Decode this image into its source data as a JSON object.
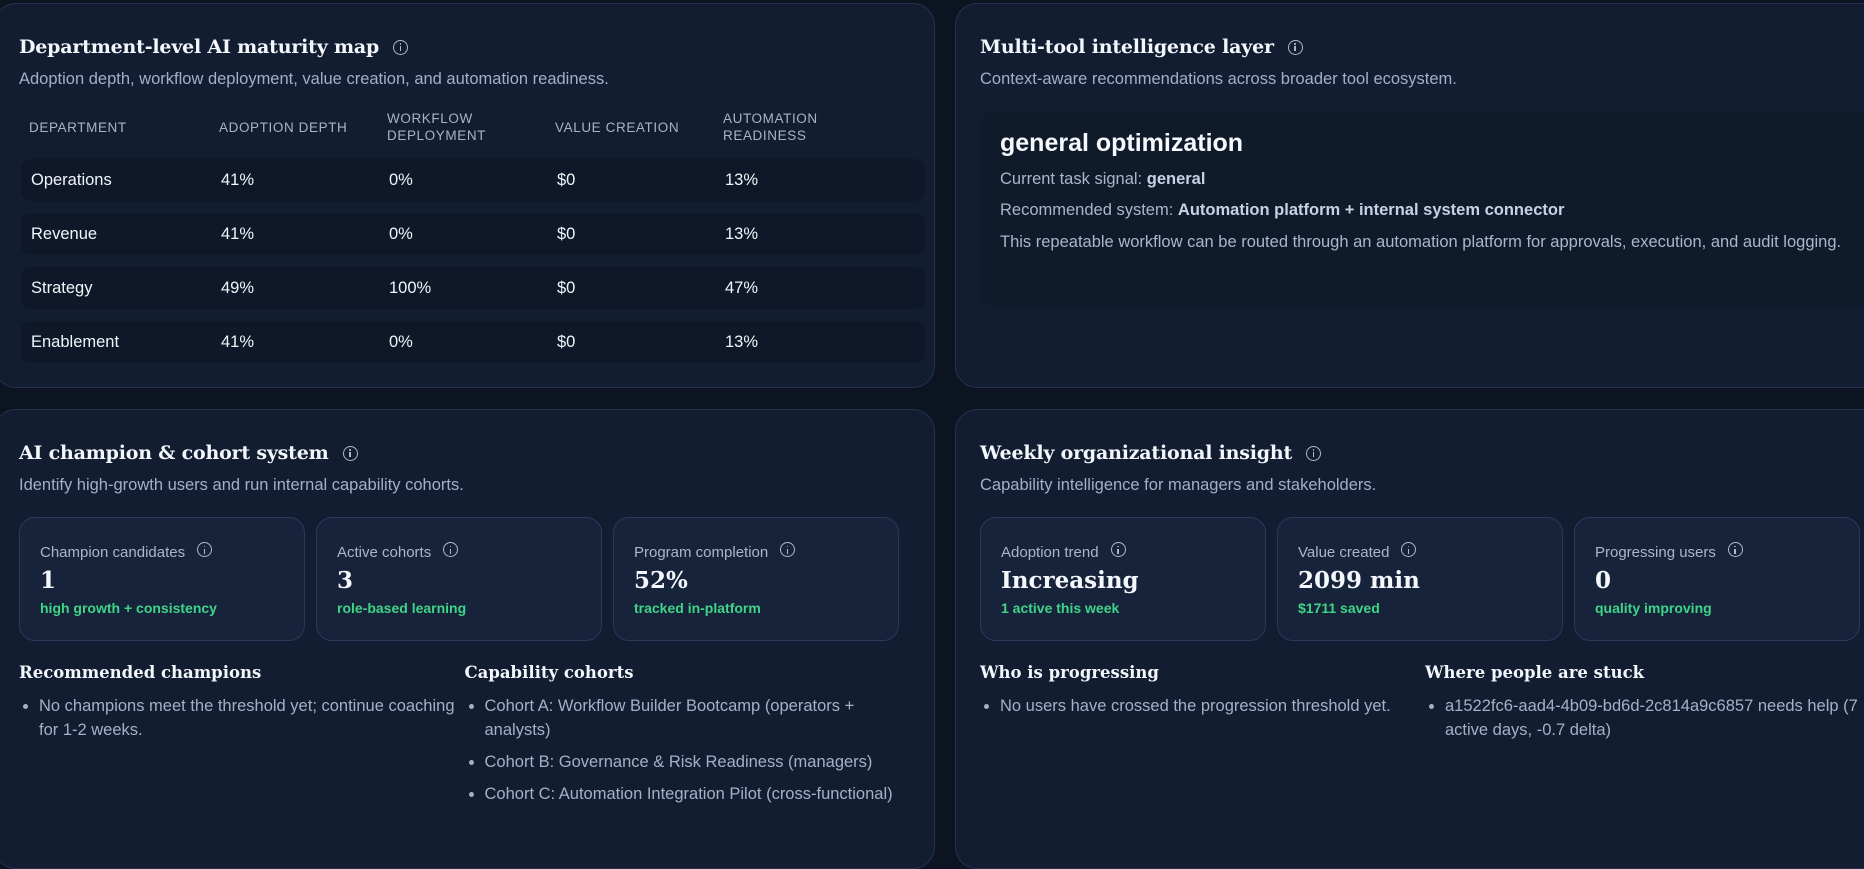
{
  "maturity": {
    "title": "Department-level AI maturity map",
    "subtitle": "Adoption depth, workflow deployment, value creation, and automation readiness.",
    "columns": [
      "DEPARTMENT",
      "ADOPTION DEPTH",
      "WORKFLOW DEPLOYMENT",
      "VALUE CREATION",
      "AUTOMATION READINESS"
    ],
    "rows": [
      [
        "Operations",
        "41%",
        "0%",
        "$0",
        "13%"
      ],
      [
        "Revenue",
        "41%",
        "0%",
        "$0",
        "13%"
      ],
      [
        "Strategy",
        "49%",
        "100%",
        "$0",
        "47%"
      ],
      [
        "Enablement",
        "41%",
        "0%",
        "$0",
        "13%"
      ]
    ]
  },
  "multitool": {
    "title": "Multi-tool intelligence layer",
    "subtitle": "Context-aware recommendations across broader tool ecosystem.",
    "reco_title": "general optimization",
    "signal_label": "Current task signal:",
    "signal_value": "general",
    "system_label": "Recommended system:",
    "system_value": "Automation platform + internal system connector",
    "description": "This repeatable workflow can be routed through an automation platform for approvals, execution, and audit logging."
  },
  "champion": {
    "title": "AI champion & cohort system",
    "subtitle": "Identify high-growth users and run internal capability cohorts.",
    "tiles": [
      {
        "label": "Champion candidates",
        "value": "1",
        "note": "high growth + consistency"
      },
      {
        "label": "Active cohorts",
        "value": "3",
        "note": "role-based learning"
      },
      {
        "label": "Program completion",
        "value": "52%",
        "note": "tracked in-platform"
      }
    ],
    "recommended_title": "Recommended champions",
    "recommended_items": [
      "No champions meet the threshold yet; continue coaching for 1-2 weeks."
    ],
    "cohorts_title": "Capability cohorts",
    "cohorts_items": [
      "Cohort A: Workflow Builder Bootcamp (operators + analysts)",
      "Cohort B: Governance & Risk Readiness (managers)",
      "Cohort C: Automation Integration Pilot (cross-functional)"
    ]
  },
  "weekly": {
    "title": "Weekly organizational insight",
    "subtitle": "Capability intelligence for managers and stakeholders.",
    "tiles": [
      {
        "label": "Adoption trend",
        "value": "Increasing",
        "note": "1 active this week"
      },
      {
        "label": "Value created",
        "value": "2099 min",
        "note": "$1711 saved"
      },
      {
        "label": "Progressing users",
        "value": "0",
        "note": "quality improving"
      }
    ],
    "progressing_title": "Who is progressing",
    "progressing_items": [
      "No users have crossed the progression threshold yet."
    ],
    "stuck_title": "Where people are stuck",
    "stuck_items": [
      "a1522fc6-aad4-4b09-bd6d-2c814a9c6857 needs help (7 active days, -0.7 delta)"
    ]
  },
  "colors": {
    "accent_green": "#3fd487",
    "card_bg": "#121d31",
    "page_bg": "#0c1422"
  }
}
